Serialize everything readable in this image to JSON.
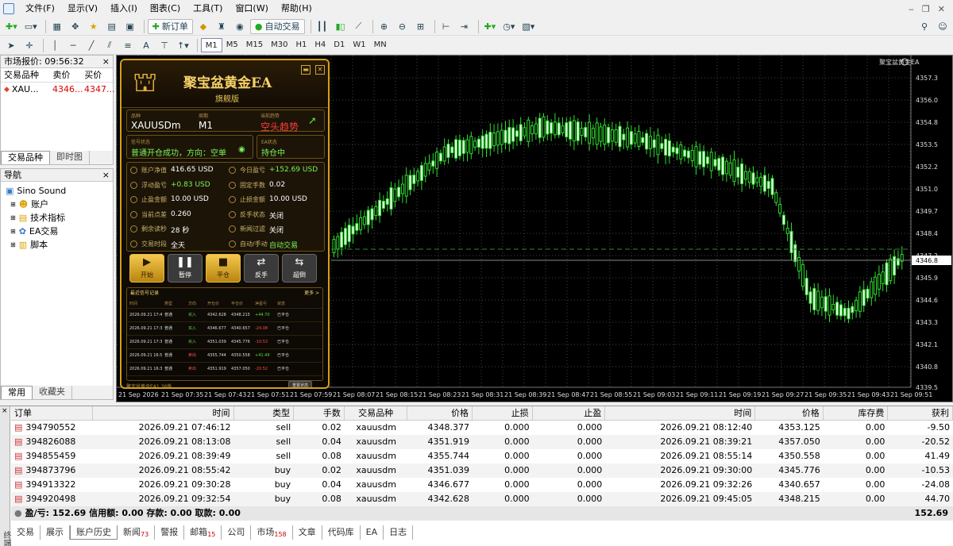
{
  "menu": [
    "文件(F)",
    "显示(V)",
    "插入(I)",
    "图表(C)",
    "工具(T)",
    "窗口(W)",
    "帮助(H)"
  ],
  "toolbar": {
    "new_order": "新订单",
    "auto_trading": "自动交易"
  },
  "timeframes": [
    "M1",
    "M5",
    "M15",
    "M30",
    "H1",
    "H4",
    "D1",
    "W1",
    "MN"
  ],
  "active_timeframe": "M1",
  "market_watch": {
    "title": "市场报价: 09:56:32",
    "headers": [
      "交易品种",
      "卖价",
      "买价"
    ],
    "rows": [
      {
        "symbol": "XAU...",
        "bid": "4346...",
        "ask": "4347..."
      }
    ],
    "tabs": [
      "交易品种",
      "即时图"
    ]
  },
  "navigator": {
    "title": "导航",
    "root": "Sino Sound",
    "items": [
      "账户",
      "技术指标",
      "EA交易",
      "脚本"
    ],
    "tabs": [
      "常用",
      "收藏夹"
    ]
  },
  "chart": {
    "label": "聚宝盆黄金EA",
    "price_ticks": [
      "4357.3",
      "4356.0",
      "4354.8",
      "4353.5",
      "4352.2",
      "4351.0",
      "4349.7",
      "4348.4",
      "4347.2",
      "4346.8",
      "4345.9",
      "4344.6",
      "4343.3",
      "4342.1",
      "4340.8",
      "4339.5"
    ],
    "current_price": "4346.8",
    "time_ticks": [
      "21 Sep 2026",
      "21 Sep 07:35",
      "21 Sep 07:43",
      "21 Sep 07:51",
      "21 Sep 07:59",
      "21 Sep 08:07",
      "21 Sep 08:15",
      "21 Sep 08:23",
      "21 Sep 08:31",
      "21 Sep 08:39",
      "21 Sep 08:47",
      "21 Sep 08:55",
      "21 Sep 09:03",
      "21 Sep 09:11",
      "21 Sep 09:19",
      "21 Sep 09:27",
      "21 Sep 09:35",
      "21 Sep 09:43",
      "21 Sep 09:51"
    ]
  },
  "ea": {
    "title": "聚宝盆黄金EA",
    "subtitle": "旗舰版",
    "symbol_label": "品种",
    "symbol": "XAUUSDm",
    "period_label": "周期",
    "period": "M1",
    "trend_label": "当前趋势",
    "trend": "空头趋势",
    "signal_label": "信号状态",
    "signal": "普通开仓成功，方向：空单",
    "ea_state_label": "EA状态",
    "ea_state": "持仓中",
    "grid": [
      {
        "k": "账户净值",
        "v": "416.65 USD"
      },
      {
        "k": "今日盈亏",
        "v": "+152.69 USD"
      },
      {
        "k": "浮动盈亏",
        "v": "+0.83 USD"
      },
      {
        "k": "固定手数",
        "v": "0.02"
      },
      {
        "k": "止盈金额",
        "v": "10.00 USD"
      },
      {
        "k": "止损金额",
        "v": "10.00 USD"
      },
      {
        "k": "当前点差",
        "v": "0.260"
      },
      {
        "k": "反手状态",
        "v": "关闭"
      },
      {
        "k": "剩余读秒",
        "v": "28 秒"
      },
      {
        "k": "新闻过滤",
        "v": "关闭"
      },
      {
        "k": "交易时段",
        "v": "全天"
      },
      {
        "k": "自动/手动",
        "v": "自动交易"
      }
    ],
    "buttons": [
      {
        "icon": "▶",
        "label": "开始"
      },
      {
        "icon": "❚❚",
        "label": "暂停"
      },
      {
        "icon": "■",
        "label": "平仓"
      },
      {
        "icon": "⇄",
        "label": "反手"
      },
      {
        "icon": "⇆",
        "label": "超倒"
      }
    ],
    "signals_title": "最近信号记录",
    "signals_more": "更多 >",
    "signals_headers": [
      "时间",
      "类型",
      "方向",
      "开仓价",
      "平仓价",
      "净盈亏",
      "状态"
    ],
    "signals": [
      [
        "2026.09.21 17:45",
        "普通",
        "买入",
        "4342.628",
        "4348.215",
        "+44.70",
        "已平仓"
      ],
      [
        "2026.09.21 17:32",
        "普通",
        "买入",
        "4346.677",
        "4340.657",
        "-24.08",
        "已平仓"
      ],
      [
        "2026.09.21 17:30",
        "普通",
        "买入",
        "4351.039",
        "4345.776",
        "-10.53",
        "已平仓"
      ],
      [
        "2026.09.21 16:55",
        "普通",
        "卖出",
        "4355.744",
        "4350.558",
        "+41.49",
        "已平仓"
      ],
      [
        "2026.09.21 16:39",
        "普通",
        "卖出",
        "4351.919",
        "4357.050",
        "-20.52",
        "已平仓"
      ]
    ],
    "footer": "聚宝盆黄金EA1.36版",
    "reset": "重置状态"
  },
  "history": {
    "headers": [
      "订单",
      "时间",
      "类型",
      "手数",
      "交易品种",
      "价格",
      "止损",
      "止盈",
      "时间",
      "价格",
      "库存费",
      "获利"
    ],
    "rows": [
      [
        "394790552",
        "2026.09.21 07:46:12",
        "sell",
        "0.02",
        "xauusdm",
        "4348.377",
        "0.000",
        "0.000",
        "2026.09.21 08:12:40",
        "4353.125",
        "0.00",
        "-9.50"
      ],
      [
        "394826088",
        "2026.09.21 08:13:08",
        "sell",
        "0.04",
        "xauusdm",
        "4351.919",
        "0.000",
        "0.000",
        "2026.09.21 08:39:21",
        "4357.050",
        "0.00",
        "-20.52"
      ],
      [
        "394855459",
        "2026.09.21 08:39:49",
        "sell",
        "0.08",
        "xauusdm",
        "4355.744",
        "0.000",
        "0.000",
        "2026.09.21 08:55:14",
        "4350.558",
        "0.00",
        "41.49"
      ],
      [
        "394873796",
        "2026.09.21 08:55:42",
        "buy",
        "0.02",
        "xauusdm",
        "4351.039",
        "0.000",
        "0.000",
        "2026.09.21 09:30:00",
        "4345.776",
        "0.00",
        "-10.53"
      ],
      [
        "394913322",
        "2026.09.21 09:30:28",
        "buy",
        "0.04",
        "xauusdm",
        "4346.677",
        "0.000",
        "0.000",
        "2026.09.21 09:32:26",
        "4340.657",
        "0.00",
        "-24.08"
      ],
      [
        "394920498",
        "2026.09.21 09:32:54",
        "buy",
        "0.08",
        "xauusdm",
        "4342.628",
        "0.000",
        "0.000",
        "2026.09.21 09:45:05",
        "4348.215",
        "0.00",
        "44.70"
      ]
    ],
    "summary": "盈/亏: 152.69  信用额: 0.00  存款: 0.00  取款: 0.00",
    "total": "152.69"
  },
  "bottom_tabs": [
    {
      "label": "交易"
    },
    {
      "label": "展示"
    },
    {
      "label": "账户历史",
      "active": true
    },
    {
      "label": "新闻",
      "badge": "73"
    },
    {
      "label": "警报"
    },
    {
      "label": "邮箱",
      "badge": "15"
    },
    {
      "label": "公司"
    },
    {
      "label": "市场",
      "badge": "158"
    },
    {
      "label": "文章"
    },
    {
      "label": "代码库"
    },
    {
      "label": "EA"
    },
    {
      "label": "日志"
    }
  ],
  "side_label": "终端"
}
